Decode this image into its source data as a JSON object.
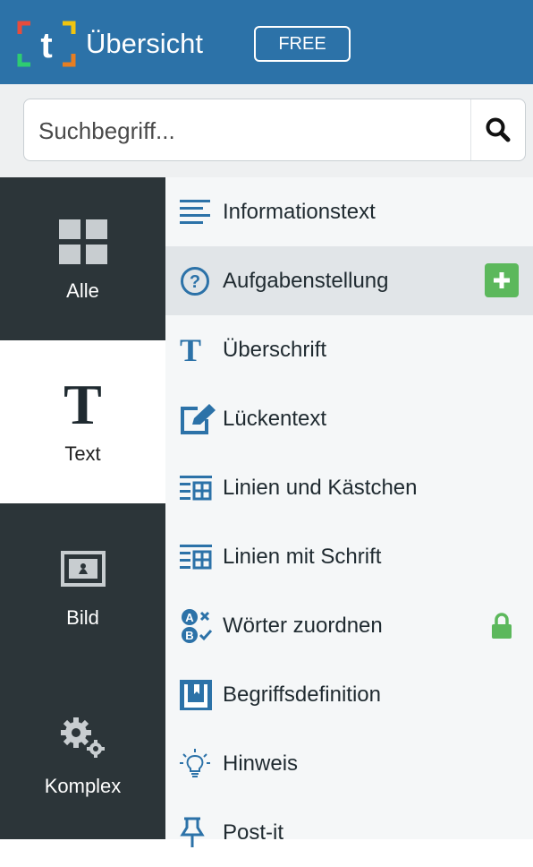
{
  "header": {
    "title": "Übersicht",
    "badge": "FREE",
    "logo_letter": "t"
  },
  "search": {
    "placeholder": "Suchbegriff...",
    "value": ""
  },
  "categories": [
    {
      "label": "Alle",
      "icon": "grid-icon",
      "active": false
    },
    {
      "label": "Text",
      "icon": "text-t-icon",
      "active": true
    },
    {
      "label": "Bild",
      "icon": "image-icon",
      "active": false
    },
    {
      "label": "Komplex",
      "icon": "gears-icon",
      "active": false
    }
  ],
  "items": [
    {
      "label": "Informationstext",
      "icon": "align-left-icon"
    },
    {
      "label": "Aufgabenstellung",
      "icon": "question-circle-icon",
      "highlighted": true,
      "action": "plus-icon"
    },
    {
      "label": "Überschrift",
      "icon": "heading-t-icon"
    },
    {
      "label": "Lückentext",
      "icon": "edit-icon"
    },
    {
      "label": "Linien und Kästchen",
      "icon": "lines-grid-icon"
    },
    {
      "label": "Linien mit Schrift",
      "icon": "lines-grid-icon"
    },
    {
      "label": "Wörter zuordnen",
      "icon": "ab-match-icon",
      "locked": true
    },
    {
      "label": "Begriffsdefinition",
      "icon": "book-icon"
    },
    {
      "label": "Hinweis",
      "icon": "lightbulb-icon"
    },
    {
      "label": "Post-it",
      "icon": "pushpin-icon"
    }
  ],
  "colors": {
    "header_bg": "#2c72a8",
    "sidebar_dark": "#2c3539",
    "accent_blue": "#2c72a8",
    "add_green": "#5cb85c",
    "lock_green": "#5cb85c"
  }
}
